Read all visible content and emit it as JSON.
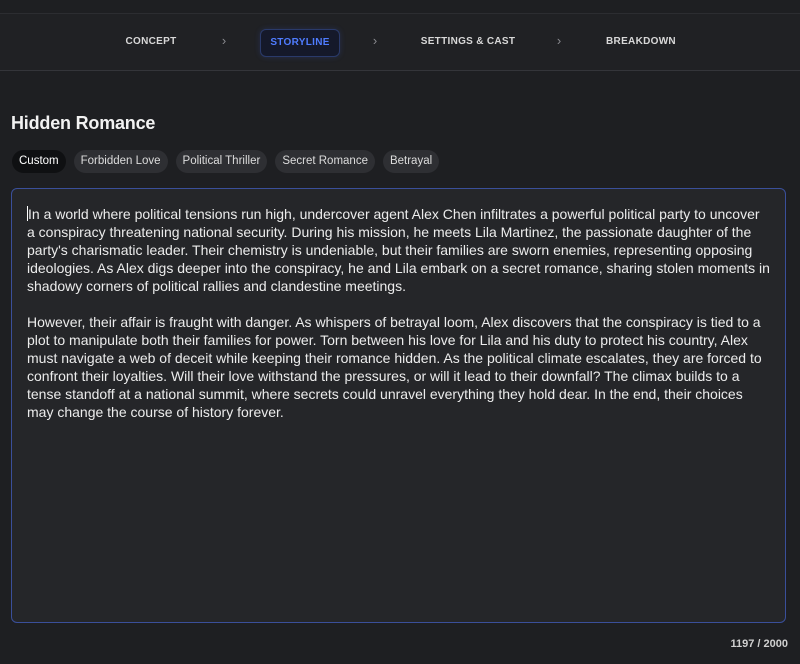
{
  "steps": [
    {
      "label": "CONCEPT"
    },
    {
      "label": "STORYLINE"
    },
    {
      "label": "SETTINGS & CAST"
    },
    {
      "label": "BREAKDOWN"
    }
  ],
  "active_step": "STORYLINE",
  "chevron_glyph": "›",
  "story": {
    "title": "Hidden Romance",
    "tags": [
      "Custom",
      "Forbidden Love",
      "Political Thriller",
      "Secret Romance",
      "Betrayal"
    ],
    "selected_tag": "Custom",
    "paragraphs": [
      "In a world where political tensions run high, undercover agent Alex Chen infiltrates a powerful political party to uncover a conspiracy threatening national security. During his mission, he meets Lila Martinez, the passionate daughter of the party's charismatic leader. Their chemistry is undeniable, but their families are sworn enemies, representing opposing ideologies. As Alex digs deeper into the conspiracy, he and Lila embark on a secret romance, sharing stolen moments in shadowy corners of political rallies and clandestine meetings.",
      "However, their affair is fraught with danger. As whispers of betrayal loom, Alex discovers that the conspiracy is tied to a plot to manipulate both their families for power. Torn between his love for Lila and his duty to protect his country, Alex must navigate a web of deceit while keeping their romance hidden. As the political climate escalates, they are forced to confront their loyalties. Will their love withstand the pressures, or will it lead to their downfall? The climax builds to a tense standoff at a national summit, where secrets could unravel everything they hold dear. In the end, their choices may change the course of history forever."
    ],
    "char_count": "1197 / 2000"
  },
  "colors": {
    "accent": "#4f7cff",
    "background": "#1e1f22",
    "editor_border": "#3a4f9a"
  }
}
